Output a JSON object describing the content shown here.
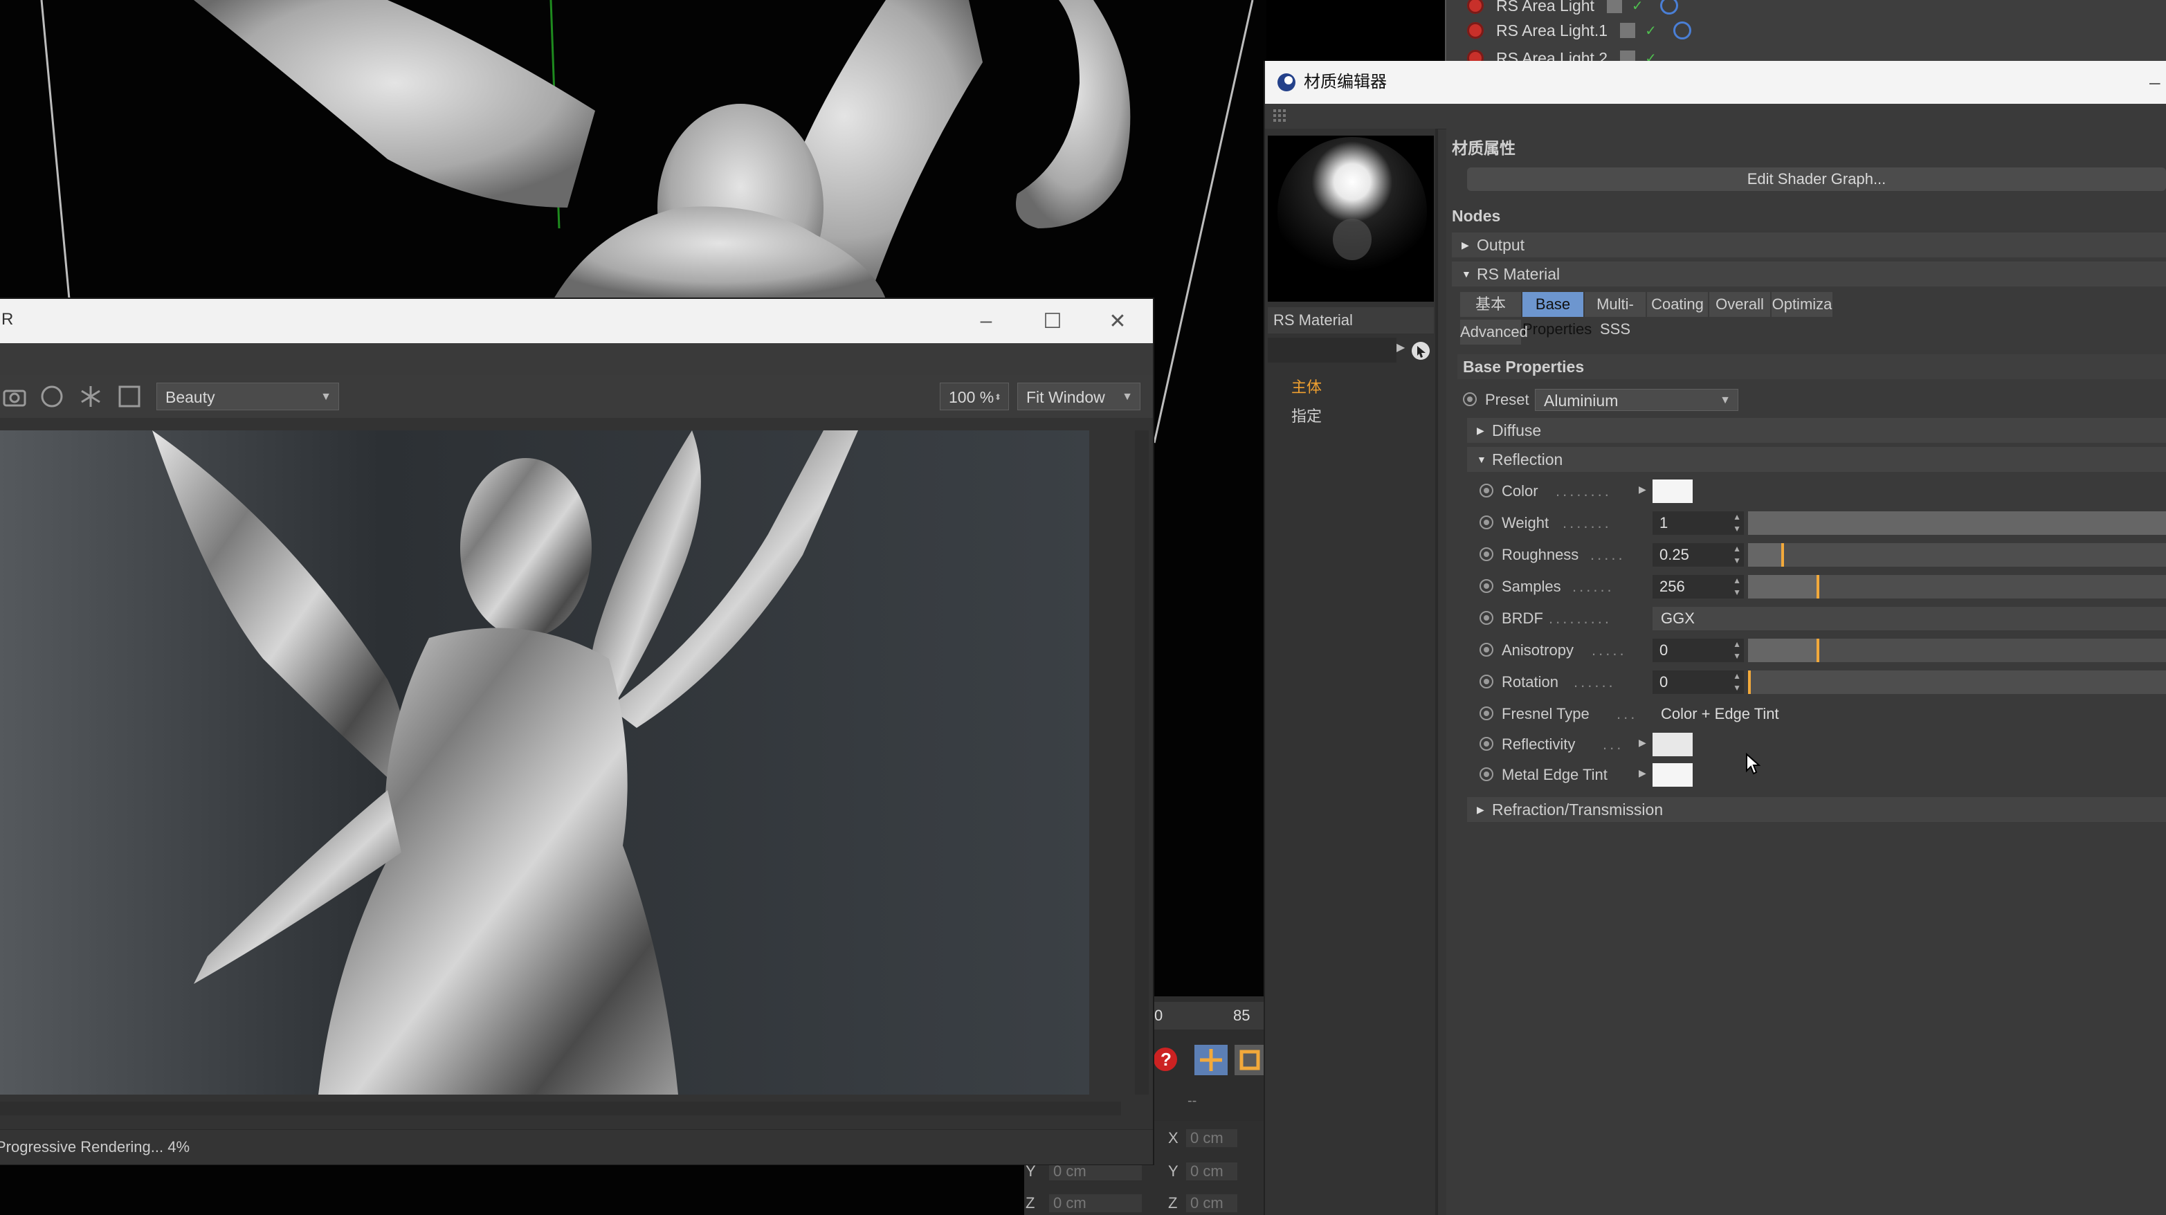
{
  "object_manager": {
    "items": [
      {
        "label": "RS Area Light"
      },
      {
        "label": "RS Area Light.1"
      },
      {
        "label": "RS Area Light.2"
      }
    ]
  },
  "render_window": {
    "title_initial": "R",
    "toolbar": {
      "channel": "Beauty",
      "zoom": "100 %",
      "fit": "Fit Window"
    },
    "status": "Progressive Rendering... 4%"
  },
  "timeline": {
    "start": "0",
    "end": "85",
    "dash": "--"
  },
  "coordinates": {
    "x_label": "X",
    "x_value": "0 cm",
    "y_label": "Y",
    "y_value": "0 cm",
    "z_label": "Z",
    "z_value": "0 cm",
    "y2_label": "Y",
    "y2_value": "0 cm",
    "z2_label": "Z",
    "z2_value": "0 cm"
  },
  "material_editor": {
    "title": "材质编辑器",
    "material_name": "RS Material",
    "nav": [
      "主体",
      "指定"
    ],
    "section_title": "材质属性",
    "edit_button": "Edit Shader Graph...",
    "nodes_title": "Nodes",
    "output_label": "Output",
    "rs_material_label": "RS Material",
    "tabs": [
      "基本",
      "Base Properties",
      "Multi-SSS",
      "Coating",
      "Overall",
      "Optimiza",
      "Advanced"
    ],
    "base_properties_title": "Base Properties",
    "preset_label": "Preset",
    "preset_value": "Aluminium",
    "diffuse_label": "Diffuse",
    "reflection_label": "Reflection",
    "refraction_label": "Refraction/Transmission",
    "props": {
      "color": {
        "label": "Color"
      },
      "weight": {
        "label": "Weight",
        "value": "1",
        "level": 1.0
      },
      "roughness": {
        "label": "Roughness",
        "value": "0.25",
        "level": 0.25
      },
      "samples": {
        "label": "Samples",
        "value": "256",
        "level": 0.5
      },
      "brdf": {
        "label": "BRDF",
        "value": "GGX"
      },
      "anisotropy": {
        "label": "Anisotropy",
        "value": "0",
        "level": 0.5
      },
      "rotation": {
        "label": "Rotation",
        "value": "0",
        "level": 0.0
      },
      "fresnel": {
        "label": "Fresnel Type",
        "value": "Color + Edge Tint"
      },
      "reflectivity": {
        "label": "Reflectivity"
      },
      "metal_edge_tint": {
        "label": "Metal Edge Tint"
      }
    },
    "colors": {
      "tab_active": "#6d96cf",
      "slider_marker": "#f2a93b",
      "nav_active": "#f0a030"
    }
  }
}
